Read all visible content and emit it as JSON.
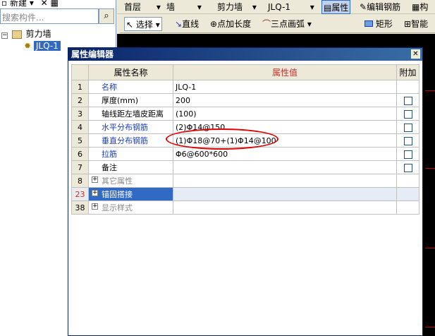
{
  "toolbar": {
    "new_label": "新建",
    "floor": "首层",
    "category": "墙",
    "type": "剪力墙",
    "component": "JLQ-1",
    "properties_label": "属性",
    "edit_rebar_label": "编辑钢筋",
    "component_list_label": "构"
  },
  "toolbar2": {
    "select_label": "选择",
    "line_label": "直线",
    "point_length_label": "点加长度",
    "arc_label": "三点画弧",
    "rect_label": "矩形",
    "smart_label": "智能"
  },
  "left": {
    "search_placeholder": "搜索构件...",
    "tree_root": "剪力墙",
    "tree_child": "JLQ-1"
  },
  "dialog": {
    "title": "属性编辑器",
    "headers": {
      "name": "属性名称",
      "value": "属性值",
      "extra": "附加"
    },
    "rows": [
      {
        "num": "1",
        "name": "名称",
        "value": "JLQ-1",
        "checkbox": false,
        "style": "blue"
      },
      {
        "num": "2",
        "name": "厚度(mm)",
        "value": "200",
        "checkbox": true,
        "style": "black"
      },
      {
        "num": "3",
        "name": "轴线距左墙皮距离",
        "value": "(100)",
        "checkbox": true,
        "style": "black"
      },
      {
        "num": "4",
        "name": "水平分布钢筋",
        "value": "(2)Φ14@150",
        "checkbox": true,
        "style": "blue"
      },
      {
        "num": "5",
        "name": "垂直分布钢筋",
        "value": "(1)Φ18@70+(1)Φ14@100",
        "checkbox": true,
        "style": "blue"
      },
      {
        "num": "6",
        "name": "拉筋",
        "value": "Φ6@600*600",
        "checkbox": true,
        "style": "blue"
      },
      {
        "num": "7",
        "name": "备注",
        "value": "",
        "checkbox": true,
        "style": "black"
      },
      {
        "num": "8",
        "name": "其它属性",
        "value": "",
        "checkbox": false,
        "style": "gray"
      },
      {
        "num": "23",
        "name": "锚固搭接",
        "value": "",
        "checkbox": false,
        "style": "selected"
      },
      {
        "num": "38",
        "name": "显示样式",
        "value": "",
        "checkbox": false,
        "style": "gray"
      }
    ]
  }
}
